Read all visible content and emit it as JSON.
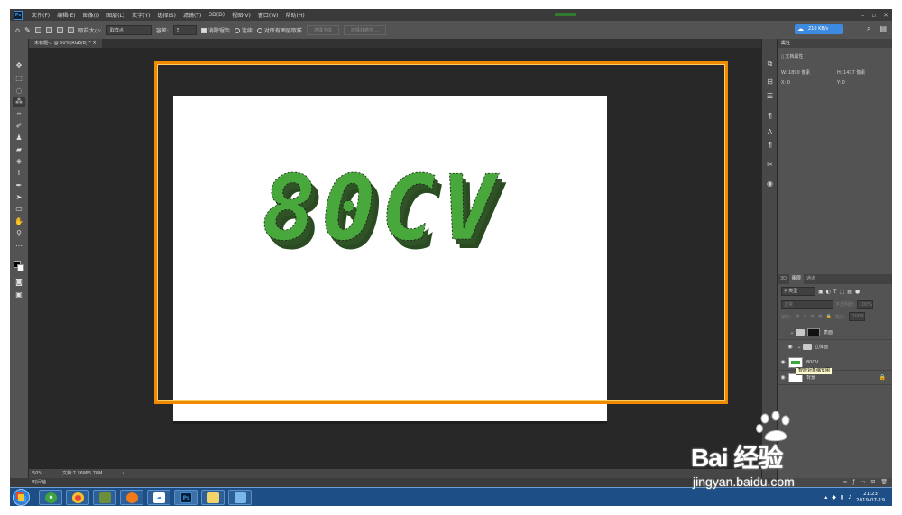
{
  "app": {
    "logo": "Ps",
    "menu": [
      "文件(F)",
      "编辑(E)",
      "图像(I)",
      "图层(L)",
      "文字(Y)",
      "选择(S)",
      "滤镜(T)",
      "3D(D)",
      "视图(V)",
      "窗口(W)",
      "帮助(H)"
    ],
    "window_buttons": [
      "–",
      "▫",
      "✕"
    ]
  },
  "options_bar": {
    "sample_size_label": "取样大小:",
    "sample_size_value": "取样点",
    "tolerance_label": "容差:",
    "tolerance_value": "5",
    "anti_alias_label": "消除锯齿",
    "contiguous_label": "连续",
    "sample_all_label": "对所有图层取样",
    "select_subject_label": "选择主体",
    "refine_edge_label": "选择并遮住 ...",
    "speed_badge": "210 KB/s"
  },
  "document": {
    "tab_label": "未标题-1 @ 50%(RGB/8) *",
    "tab_close": "×"
  },
  "artwork": {
    "text": "80CV",
    "face_color": "#49a83b",
    "side_color": "#2a4a22",
    "highlight_color": "#f08a00"
  },
  "status": {
    "zoom": "50%",
    "doc_size": "文档:7.66M/5.78M",
    "arrow": "›"
  },
  "timeline": {
    "label": "时间轴"
  },
  "properties": {
    "title": "属性",
    "doc_props": "文档属性",
    "w_label": "W:",
    "w_value": "1890 像素",
    "h_label": "H:",
    "h_value": "1417 像素",
    "x_label": "X:",
    "x_value": "0",
    "y_label": "Y:",
    "y_value": "0"
  },
  "layers": {
    "tabs": [
      "3D",
      "图层",
      "通道"
    ],
    "kind_filter": "类型",
    "blend_mode": "正常",
    "opacity_label": "不透明度:",
    "opacity_value": "100%",
    "lock_label": "锁定:",
    "fill_label": "填充:",
    "fill_value": "100%",
    "rows": [
      {
        "name": "表面",
        "thumb_text": "80CV"
      },
      {
        "name": "立体面"
      },
      {
        "name": "80CV"
      },
      {
        "name": "背景"
      }
    ],
    "tooltip": "智能对象缩览图"
  },
  "taskbar": {
    "time": "21:23",
    "date": "2019-07-19",
    "apps": [
      "explorer",
      "chrome",
      "minecraft",
      "firefox",
      "baidu-netdisk",
      "photoshop",
      "file-manager",
      "paint"
    ]
  },
  "watermark": {
    "brand": "Bai 经验",
    "du": "du",
    "url": "jingyan.baidu.com"
  }
}
